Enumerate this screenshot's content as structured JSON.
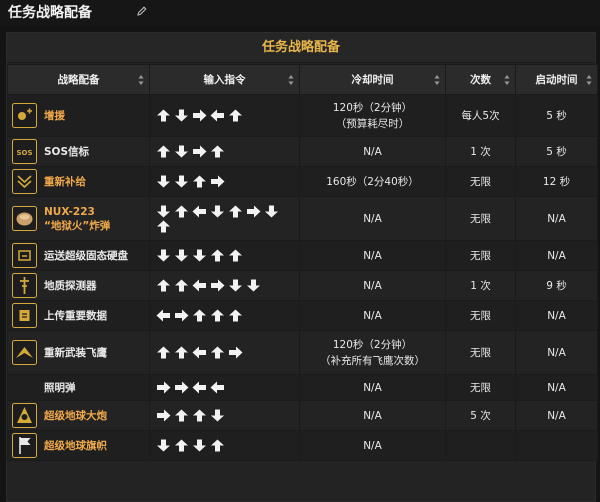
{
  "page": {
    "title": "任务战略配备"
  },
  "table": {
    "caption": "任务战略配备",
    "headers": [
      "战略配备",
      "输入指令",
      "冷却时间",
      "次数",
      "启动时间"
    ],
    "rows": [
      {
        "name": "增援",
        "name_color": "orange",
        "icon": "reinforce-icon",
        "input": [
          "up",
          "down",
          "right",
          "left",
          "up"
        ],
        "cooldown": [
          "120秒（2分钟）",
          "（预算耗尽时）"
        ],
        "uses": "每人5次",
        "activation": "5 秒"
      },
      {
        "name": "SOS信标",
        "name_color": "white",
        "icon": "sos-beacon-icon",
        "input": [
          "up",
          "down",
          "right",
          "up"
        ],
        "cooldown": [
          "N/A"
        ],
        "uses": "1 次",
        "activation": "5 秒"
      },
      {
        "name": "重新补给",
        "name_color": "orange",
        "icon": "resupply-icon",
        "input": [
          "down",
          "down",
          "up",
          "right"
        ],
        "cooldown": [
          "160秒（2分40秒）"
        ],
        "uses": "无限",
        "activation": "12 秒"
      },
      {
        "name": "NUX-223\n“地狱火”炸弹",
        "name_color": "orange",
        "icon": "hellbomb-icon",
        "input": [
          "down",
          "up",
          "left",
          "down",
          "up",
          "right",
          "down",
          "up"
        ],
        "cooldown": [
          "N/A"
        ],
        "uses": "无限",
        "activation": "N/A"
      },
      {
        "name": "运送超级固态硬盘",
        "name_color": "white",
        "icon": "ssd-delivery-icon",
        "input": [
          "down",
          "down",
          "down",
          "up",
          "up"
        ],
        "cooldown": [
          "N/A"
        ],
        "uses": "无限",
        "activation": "N/A"
      },
      {
        "name": "地质探测器",
        "name_color": "white",
        "icon": "seismic-probe-icon",
        "input": [
          "up",
          "up",
          "left",
          "right",
          "down",
          "down"
        ],
        "cooldown": [
          "N/A"
        ],
        "uses": "1 次",
        "activation": "9 秒"
      },
      {
        "name": "上传重要数据",
        "name_color": "white",
        "icon": "upload-data-icon",
        "input": [
          "left",
          "right",
          "up",
          "up",
          "up"
        ],
        "cooldown": [
          "N/A"
        ],
        "uses": "无限",
        "activation": "N/A"
      },
      {
        "name": "重新武装飞鹰",
        "name_color": "white",
        "icon": "eagle-rearm-icon",
        "input": [
          "up",
          "up",
          "left",
          "up",
          "right"
        ],
        "cooldown": [
          "120秒（2分钟）",
          "（补充所有飞鹰次数）"
        ],
        "uses": "无限",
        "activation": "N/A"
      },
      {
        "name": "照明弹",
        "name_color": "white",
        "icon": "",
        "input": [
          "right",
          "right",
          "left",
          "left"
        ],
        "cooldown": [
          "N/A"
        ],
        "uses": "无限",
        "activation": "N/A"
      },
      {
        "name": "超级地球大炮",
        "name_color": "orange",
        "icon": "super-earth-cannon-icon",
        "input": [
          "right",
          "up",
          "up",
          "down"
        ],
        "cooldown": [
          "N/A"
        ],
        "uses": "5 次",
        "activation": "N/A"
      },
      {
        "name": "超级地球旗帜",
        "name_color": "orange",
        "icon": "super-earth-flag-icon",
        "input": [
          "down",
          "up",
          "down",
          "up"
        ],
        "cooldown": [
          "N/A"
        ],
        "uses": "",
        "activation": ""
      }
    ]
  },
  "colors": {
    "accent": "#e8b54a",
    "name_orange": "#f0a94a",
    "icon_border": "#d4a93a"
  }
}
